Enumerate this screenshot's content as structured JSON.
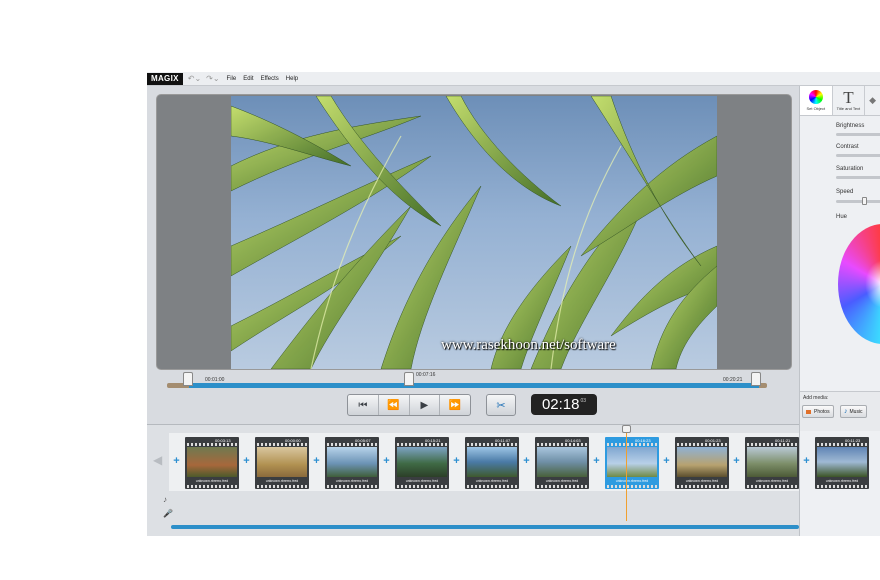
{
  "app": {
    "logo": "MAGIX",
    "menu": [
      "File",
      "Edit",
      "Effects",
      "Help"
    ]
  },
  "preview": {
    "watermark": "www.rasekhoon.net/software",
    "scrub_start": "00:01:00",
    "scrub_mid": "00:07:16",
    "scrub_end": "00:20:21",
    "scrub_progress": 0.42
  },
  "transport": {
    "timecode": "02:18",
    "timecode_frames": "03"
  },
  "panel": {
    "tabs": [
      {
        "label": "Set Object",
        "icon": "color-wheel-icon"
      },
      {
        "label": "Title and Text",
        "icon": "title-text-icon"
      }
    ],
    "sliders": [
      "Brightness",
      "Contrast",
      "Saturation",
      "Speed"
    ],
    "hue_label": "Hue",
    "add_media_label": "Add media:",
    "photos_label": "Photos",
    "music_label": "Music"
  },
  "timeline": {
    "clips": [
      {
        "time": "00:03:13",
        "label": "unknown.rbrerro.fred"
      },
      {
        "time": "00:00:00",
        "label": "unknown.rbrerro.fred"
      },
      {
        "time": "00:05:07",
        "label": "unknown.rbrerro.fred"
      },
      {
        "time": "00:15:21",
        "label": "unknown.rbrerro.fred"
      },
      {
        "time": "00:11:07",
        "label": "unknown.rbrerro.fred"
      },
      {
        "time": "00:14:03",
        "label": "unknown.rbrerro.fred"
      },
      {
        "time": "00:16:23",
        "label": "unknown.rbrerro.fred"
      },
      {
        "time": "00:01:23",
        "label": "unknown.rbrerro.fred"
      },
      {
        "time": "00:11:21",
        "label": "unknown.rbrerro.fred"
      },
      {
        "time": "00:11:23",
        "label": "unknown.rbrerro.fred"
      }
    ]
  },
  "colors": {
    "accent": "#2c8fc9",
    "playhead": "#f0a030"
  }
}
